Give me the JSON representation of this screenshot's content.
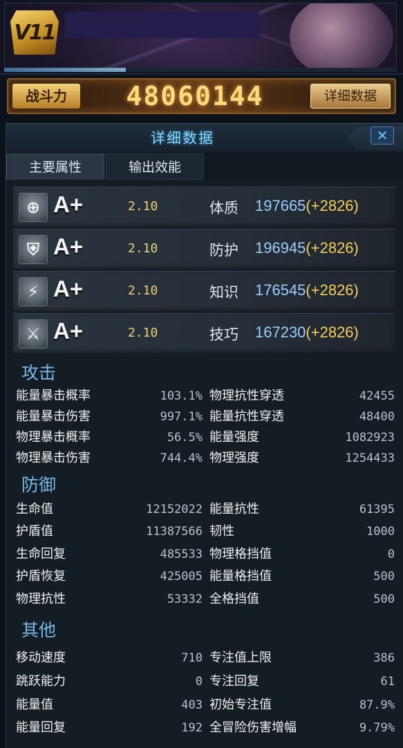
{
  "header": {
    "rank_badge": "V11",
    "xp_progress": 0.31
  },
  "power": {
    "label": "战斗力",
    "value": "48060144",
    "detail_button": "详细数据"
  },
  "panel": {
    "title": "详细数据",
    "close_label": "✕",
    "tabs": [
      {
        "label": "主要属性",
        "active": true
      },
      {
        "label": "输出效能",
        "active": false
      }
    ]
  },
  "attributes": [
    {
      "icon": "plus-circle-icon",
      "glyph": "⊕",
      "grade": "A+",
      "coef": "2.10",
      "name": "体质",
      "value": "197665",
      "bonus": "(+2826)"
    },
    {
      "icon": "shield-icon",
      "glyph": "⛨",
      "grade": "A+",
      "coef": "2.10",
      "name": "防护",
      "value": "196945",
      "bonus": "(+2826)"
    },
    {
      "icon": "lightning-icon",
      "glyph": "⚡",
      "grade": "A+",
      "coef": "2.10",
      "name": "知识",
      "value": "176545",
      "bonus": "(+2826)"
    },
    {
      "icon": "sword-icon",
      "glyph": "⚔",
      "grade": "A+",
      "coef": "2.10",
      "name": "技巧",
      "value": "167230",
      "bonus": "(+2826)"
    }
  ],
  "sections": {
    "attack": {
      "title": "攻击",
      "left": [
        {
          "label": "能量暴击概率",
          "value": "103.1%"
        },
        {
          "label": "能量暴击伤害",
          "value": "997.1%"
        },
        {
          "label": "物理暴击概率",
          "value": "56.5%"
        },
        {
          "label": "物理暴击伤害",
          "value": "744.4%"
        }
      ],
      "right": [
        {
          "label": "物理抗性穿透",
          "value": "42455"
        },
        {
          "label": "能量抗性穿透",
          "value": "48400"
        },
        {
          "label": "能量强度",
          "value": "1082923"
        },
        {
          "label": "物理强度",
          "value": "1254433"
        }
      ]
    },
    "defense": {
      "title": "防御",
      "left": [
        {
          "label": "生命值",
          "value": "12152022"
        },
        {
          "label": "护盾值",
          "value": "11387566"
        },
        {
          "label": "生命回复",
          "value": "485533"
        },
        {
          "label": "护盾恢复",
          "value": "425005"
        },
        {
          "label": "物理抗性",
          "value": "53332"
        }
      ],
      "right": [
        {
          "label": "能量抗性",
          "value": "61395"
        },
        {
          "label": "韧性",
          "value": "1000"
        },
        {
          "label": "物理格挡值",
          "value": "0"
        },
        {
          "label": "能量格挡值",
          "value": "500"
        },
        {
          "label": "全格挡值",
          "value": "500"
        }
      ]
    },
    "other": {
      "title": "其他",
      "left": [
        {
          "label": "移动速度",
          "value": "710"
        },
        {
          "label": "跳跃能力",
          "value": "0"
        },
        {
          "label": "能量值",
          "value": "403"
        },
        {
          "label": "能量回复",
          "value": "192"
        }
      ],
      "right": [
        {
          "label": "专注值上限",
          "value": "386"
        },
        {
          "label": "专注回复",
          "value": "61"
        },
        {
          "label": "初始专注值",
          "value": "87.9%"
        },
        {
          "label": "全冒险伤害增幅",
          "value": "9.79%"
        }
      ]
    }
  }
}
